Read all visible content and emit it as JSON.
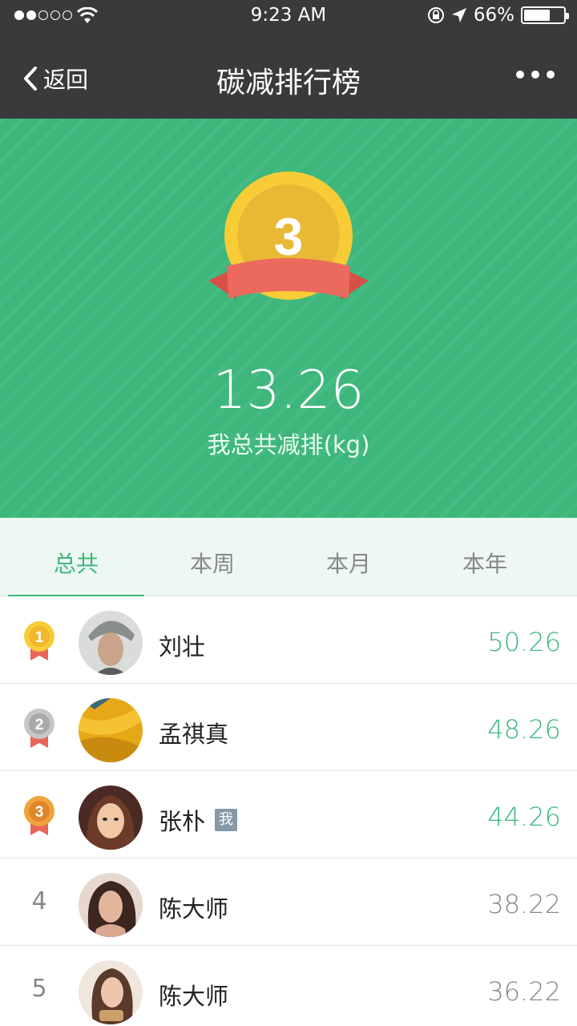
{
  "status_bar": {
    "time": "9:23 AM",
    "battery": "66%",
    "battery_level": 0.66,
    "signal_bars": 2
  },
  "nav": {
    "back_label": "返回",
    "title": "碳减排行榜",
    "more_icon": "more-dots-icon"
  },
  "hero": {
    "my_rank": "3",
    "total_value": "13.26",
    "caption": "我总共减排(kg)",
    "bg_color": "#3db77c"
  },
  "tabs": [
    {
      "label": "总共",
      "active": true
    },
    {
      "label": "本周",
      "active": false
    },
    {
      "label": "本月",
      "active": false
    },
    {
      "label": "本年",
      "active": false
    }
  ],
  "ranking": [
    {
      "rank": "1",
      "name": "刘壮",
      "score": "50.26",
      "medal": "gold",
      "me": false
    },
    {
      "rank": "2",
      "name": "孟祺真",
      "score": "48.26",
      "medal": "silver",
      "me": false
    },
    {
      "rank": "3",
      "name": "张朴",
      "score": "44.26",
      "medal": "bronze",
      "me": true,
      "me_label": "我"
    },
    {
      "rank": "4",
      "name": "陈大师",
      "score": "38.22",
      "medal": "",
      "me": false
    },
    {
      "rank": "5",
      "name": "陈大师",
      "score": "36.22",
      "medal": "",
      "me": false
    }
  ],
  "colors": {
    "accent": "#3db77c",
    "gold": "#f5c93a",
    "silver": "#b6b6b6",
    "bronze": "#e8912f",
    "ribbon": "#e8655a"
  }
}
